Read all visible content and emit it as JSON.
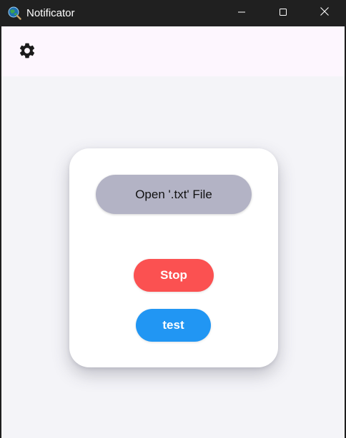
{
  "window": {
    "title": "Notificator",
    "app_icon": "globe-magnifier-icon",
    "controls": {
      "minimize_icon": "minimize-icon",
      "maximize_icon": "maximize-icon",
      "close_icon": "close-icon"
    }
  },
  "header": {
    "settings_icon": "gear-icon"
  },
  "card": {
    "open_button_label": "Open '.txt' File",
    "stop_button_label": "Stop",
    "test_button_label": "test"
  },
  "colors": {
    "open_button": "#b3b3c5",
    "stop_button": "#fb5151",
    "test_button": "#2196f3",
    "header_bg": "#fdf6fe",
    "body_bg": "#f4f4f8",
    "titlebar_bg": "#202020"
  }
}
